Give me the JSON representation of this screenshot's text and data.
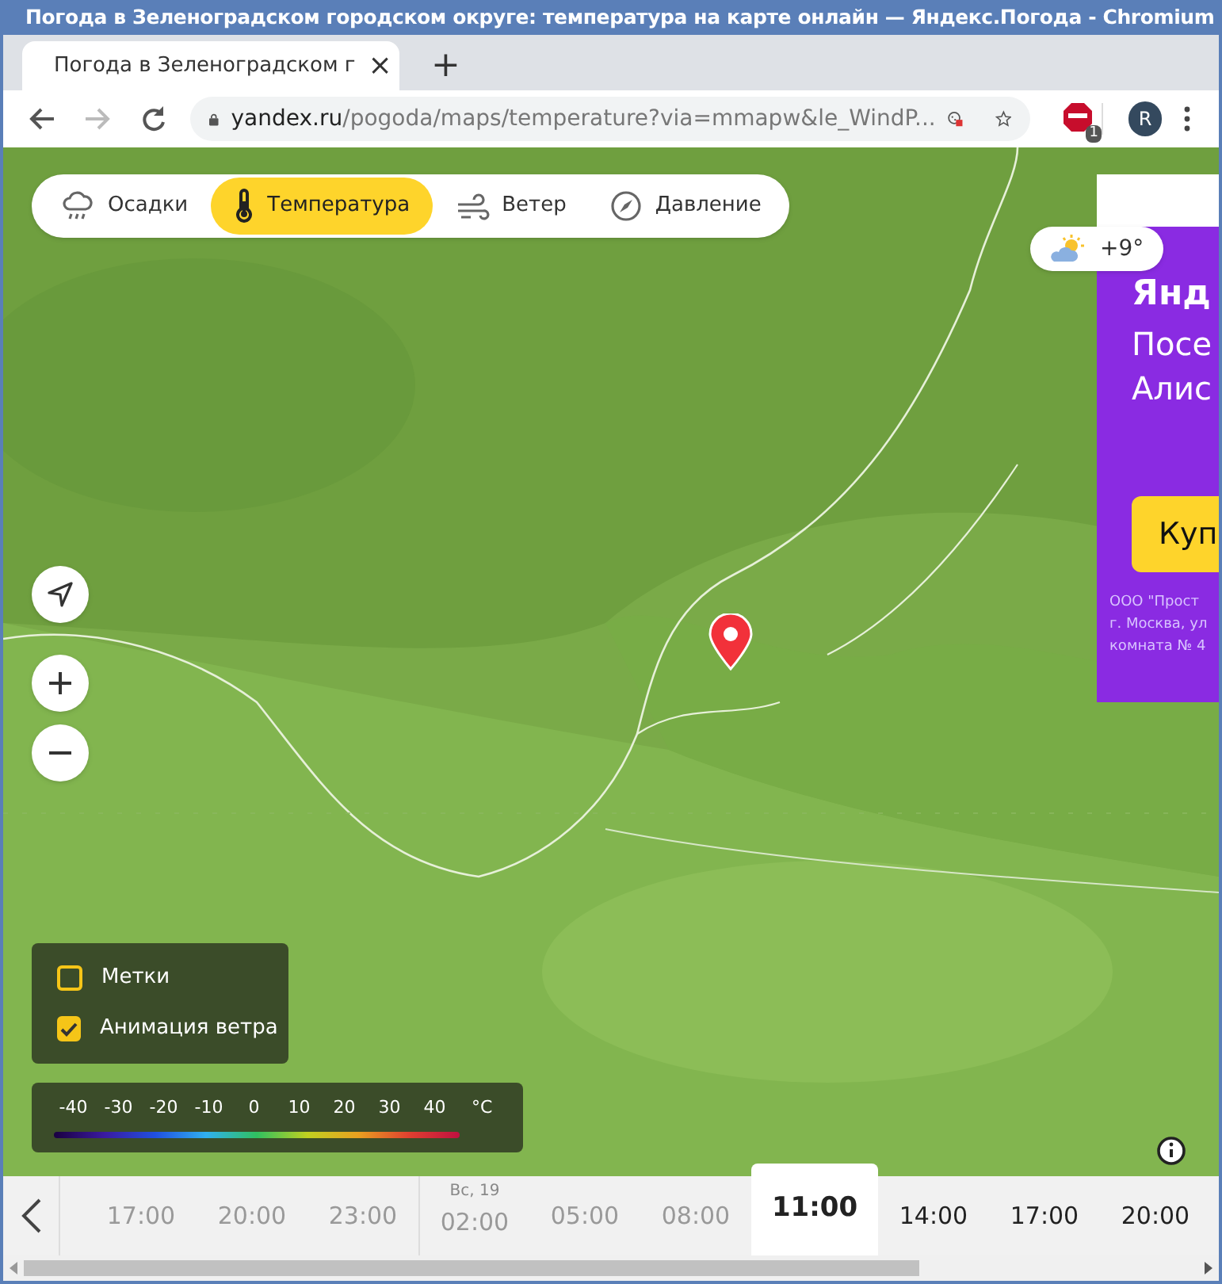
{
  "window": {
    "title": "Погода в Зеленоградском городском округе: температура на карте онлайн — Яндекс.Погода - Chromium"
  },
  "tab": {
    "title": "Погода в Зеленоградском г",
    "close": "×"
  },
  "new_tab": "+",
  "address_bar": {
    "host": "yandex.ru",
    "path": "/pogoda/maps/temperature?via=mmapw&le_WindP..."
  },
  "extension_badge": "1",
  "profile": "R",
  "layers": [
    {
      "label": "Осадки",
      "kind": "rain",
      "selected": false
    },
    {
      "label": "Температура",
      "kind": "temperature",
      "selected": true
    },
    {
      "label": "Ветер",
      "kind": "wind",
      "selected": false
    },
    {
      "label": "Давление",
      "kind": "pressure",
      "selected": false
    }
  ],
  "weather_marker": {
    "temperature": "+9°"
  },
  "ad": {
    "headline": "Янд",
    "line_1": "Посе",
    "line_2": "Алис",
    "button": "Куп",
    "legal": [
      "ООО \"Прост",
      "г. Москва, ул",
      "комната № 4"
    ]
  },
  "options": [
    {
      "label": "Метки",
      "checked": false
    },
    {
      "label": "Анимация ветра",
      "checked": true
    }
  ],
  "scale": {
    "ticks": [
      "-40",
      "-30",
      "-20",
      "-10",
      "0",
      "10",
      "20",
      "30",
      "40"
    ],
    "unit": "°C"
  },
  "timeline": [
    {
      "time": "17:00",
      "past": true,
      "selected": false
    },
    {
      "time": "20:00",
      "past": true,
      "selected": false
    },
    {
      "time": "23:00",
      "past": true,
      "selected": false
    },
    {
      "time": "02:00",
      "day": "Вс, 19",
      "past": true,
      "selected": false
    },
    {
      "time": "05:00",
      "past": true,
      "selected": false
    },
    {
      "time": "08:00",
      "past": true,
      "selected": false
    },
    {
      "time": "11:00",
      "past": false,
      "selected": true
    },
    {
      "time": "14:00",
      "past": false,
      "selected": false
    },
    {
      "time": "17:00",
      "past": false,
      "selected": false
    },
    {
      "time": "20:00",
      "past": false,
      "selected": false
    }
  ]
}
